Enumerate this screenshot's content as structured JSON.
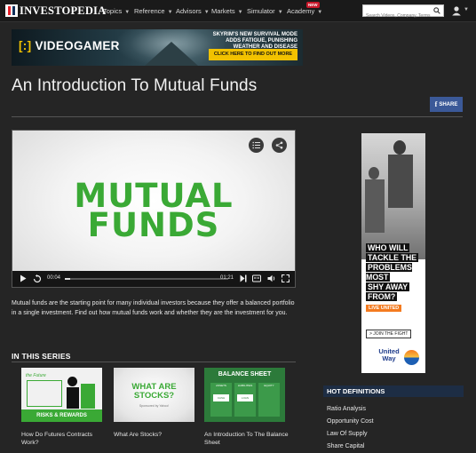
{
  "header": {
    "logo_text": "INVESTOPEDIA",
    "nav": [
      {
        "label": "Topics"
      },
      {
        "label": "Reference"
      },
      {
        "label": "Advisors"
      },
      {
        "label": "Markets"
      },
      {
        "label": "Simulator"
      },
      {
        "label": "Academy"
      }
    ],
    "new_badge": "NEW",
    "search_placeholder": "Search Videos, Company, Terms"
  },
  "banner_ad": {
    "brand_bracket": "[:]",
    "brand": "VIDEOGAMER",
    "headline": "SKYRIM'S NEW SURVIVAL MODE ADDS FATIGUE, PUNISHING WEATHER AND DISEASE",
    "cta": "CLICK HERE TO FIND OUT MORE"
  },
  "page": {
    "title": "An Introduction To Mutual Funds",
    "share_icon": "f",
    "share_label": "SHARE"
  },
  "video": {
    "title_line1": "MUTUAL",
    "title_line2": "FUNDS",
    "current_time": "00:04",
    "duration": "01:21",
    "progress": 0.03,
    "description": "Mutual funds are the starting point for many individual investors because they offer a balanced portfolio in a single investment. Find out how mutual funds work and whether they are the investment for you."
  },
  "series": {
    "heading": "IN THIS SERIES",
    "items": [
      {
        "title": "How Do Futures Contracts Work?",
        "thumb_text": "RISKS & REWARDS",
        "thumb_tag": "the Future"
      },
      {
        "title": "What Are Stocks?",
        "thumb_text": "WHAT ARE STOCKS?",
        "thumb_tag": "Sponsored by Yahoo!"
      },
      {
        "title": "An Introduction To The Balance Sheet",
        "thumb_text": "BALANCE SHEET",
        "thumb_cols": [
          "ASSETS",
          "LIABILITIES",
          "EQUITY"
        ],
        "thumb_cells": [
          "CASH",
          "LOAN"
        ]
      }
    ]
  },
  "side_ad": {
    "question": [
      "WHO WILL",
      "TACKLE THE",
      "PROBLEMS MOST",
      "SHY AWAY",
      "FROM?"
    ],
    "tag": "LIVE UNITED",
    "join": "> JOIN THE FIGHT",
    "logo_line1": "United",
    "logo_line2": "Way"
  },
  "hot_definitions": {
    "heading": "HOT DEFINITIONS",
    "items": [
      "Ratio Analysis",
      "Opportunity Cost",
      "Law Of Supply",
      "Share Capital"
    ]
  },
  "colors": {
    "background": "#252525",
    "nav": "#1a1a1a",
    "facebook": "#3b5998",
    "accent_green": "#3aa935",
    "hot_header": "#1d2d44"
  }
}
